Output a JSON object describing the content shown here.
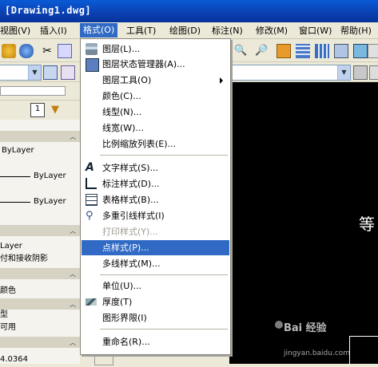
{
  "window": {
    "title": "[Drawing1.dwg]"
  },
  "menubar": {
    "items": [
      "视图(V)",
      "插入(I)",
      "格式(O)",
      "工具(T)",
      "绘图(D)",
      "标注(N)",
      "修改(M)",
      "窗口(W)",
      "帮助(H)"
    ]
  },
  "palette": {
    "rows": [
      "ByLayer",
      "ByLayer",
      "ByLayer",
      "Layer",
      "付和接收阴影",
      "颜色",
      "型",
      "可用",
      "4.0364"
    ]
  },
  "canvas": {
    "glyph": "等"
  },
  "format_menu": {
    "items": [
      {
        "label": "图层(L)...",
        "icon": "layers-icon"
      },
      {
        "label": "图层状态管理器(A)...",
        "icon": "layer-state-icon"
      },
      {
        "label": "图层工具(O)",
        "icon": "",
        "submenu": true
      },
      {
        "label": "颜色(C)...",
        "icon": ""
      },
      {
        "label": "线型(N)...",
        "icon": ""
      },
      {
        "label": "线宽(W)...",
        "icon": ""
      },
      {
        "label": "比例缩放列表(E)...",
        "icon": ""
      },
      {
        "label": "文字样式(S)...",
        "icon": "text-style-icon"
      },
      {
        "label": "标注样式(D)...",
        "icon": "dimension-style-icon"
      },
      {
        "label": "表格样式(B)...",
        "icon": "table-style-icon"
      },
      {
        "label": "多重引线样式(I)",
        "icon": "multileader-style-icon"
      },
      {
        "label": "打印样式(Y)...",
        "icon": "",
        "disabled": true
      },
      {
        "label": "点样式(P)...",
        "icon": "",
        "selected": true
      },
      {
        "label": "多线样式(M)...",
        "icon": ""
      },
      {
        "label": "单位(U)...",
        "icon": ""
      },
      {
        "label": "厚度(T)",
        "icon": "thickness-icon"
      },
      {
        "label": "图形界限(I)",
        "icon": ""
      },
      {
        "label": "重命名(R)...",
        "icon": ""
      }
    ]
  },
  "watermark": {
    "text": "Bai 经验",
    "url": "jingyan.baidu.com"
  },
  "colors": {
    "menu_highlight": "#316ac5",
    "title_bar": "#0a4cc4",
    "canvas": "#000000"
  }
}
